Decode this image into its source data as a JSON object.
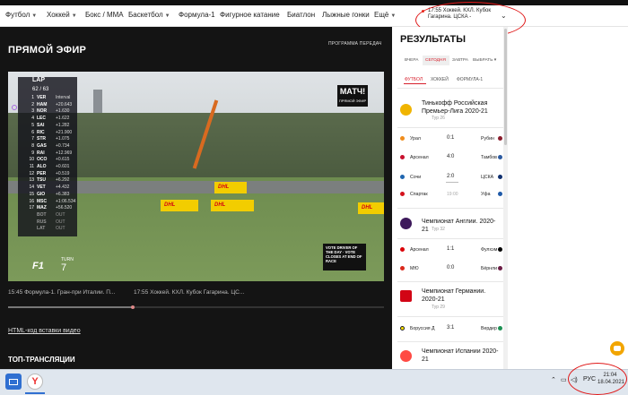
{
  "nav": {
    "items": [
      {
        "label": "Футбол",
        "dropdown": true
      },
      {
        "label": "Хоккей",
        "dropdown": true
      },
      {
        "label": "Бокс / ММА",
        "dropdown": false
      },
      {
        "label": "Баскетбол",
        "dropdown": true
      },
      {
        "label": "Формула-1",
        "dropdown": false
      },
      {
        "label": "Фигурное катание",
        "dropdown": false
      },
      {
        "label": "Биатлон",
        "dropdown": false
      },
      {
        "label": "Лыжные гонки",
        "dropdown": false
      },
      {
        "label": "Ещё",
        "dropdown": true
      }
    ],
    "current_match": "17:55 Хоккей. КХЛ. Кубок Гагарина. ЦСКА -"
  },
  "live": {
    "title": "ПРЯМОЙ ЭФИР",
    "schedule_link": "ПРОГРАММА ПЕРЕДАЧ",
    "embed_link": "HTML-код вставки видео",
    "top_streams": "ТОП-ТРАНСЛЯЦИИ",
    "thumbs": [
      "15:45 Формула-1. Гран-при Италии. П...",
      "17:55 Хоккей. КХЛ. Кубок Гагарина. ЦС..."
    ],
    "progress_fraction": 0.33
  },
  "video": {
    "lap_label": "LAP",
    "lap_count": "62 / 63",
    "interval_label": "Interval",
    "standings": [
      {
        "pos": "1",
        "code": "VER",
        "time": "Interval"
      },
      {
        "pos": "2",
        "code": "HAM",
        "time": "+20.643"
      },
      {
        "pos": "3",
        "code": "NOR",
        "time": "+1.630"
      },
      {
        "pos": "4",
        "code": "LEC",
        "time": "+1.622"
      },
      {
        "pos": "5",
        "code": "SAI",
        "time": "+1.282"
      },
      {
        "pos": "6",
        "code": "RIC",
        "time": "+21.900"
      },
      {
        "pos": "7",
        "code": "STR",
        "time": "+1.075"
      },
      {
        "pos": "8",
        "code": "GAS",
        "time": "+0.734"
      },
      {
        "pos": "9",
        "code": "RAI",
        "time": "+12.969"
      },
      {
        "pos": "10",
        "code": "OCO",
        "time": "+0.615"
      },
      {
        "pos": "11",
        "code": "ALO",
        "time": "+0.601"
      },
      {
        "pos": "12",
        "code": "PER",
        "time": "+0.519"
      },
      {
        "pos": "13",
        "code": "TSU",
        "time": "+6.292"
      },
      {
        "pos": "14",
        "code": "VET",
        "time": "+4.432"
      },
      {
        "pos": "15",
        "code": "GIO",
        "time": "+6.383"
      },
      {
        "pos": "16",
        "code": "MSC",
        "time": "+1:06.534"
      },
      {
        "pos": "17",
        "code": "MAZ",
        "time": "+56.520"
      },
      {
        "pos": "",
        "code": "BOT",
        "time": "OUT",
        "dim": true
      },
      {
        "pos": "",
        "code": "RUS",
        "time": "OUT",
        "dim": true
      },
      {
        "pos": "",
        "code": "LAT",
        "time": "OUT",
        "dim": true
      }
    ],
    "channel_logo": "МАТЧ!",
    "channel_sub": "ПРЯМОЙ ЭФИР",
    "sponsor": "DHL",
    "vote_text": "VOTE DRIVER OF THE DAY · VOTE CLOSES AT END OF RACE",
    "f1_logo": "F1",
    "turn_label": "TURN",
    "turn_number": "7"
  },
  "results": {
    "title": "РЕЗУЛЬТАТЫ",
    "day_tabs": [
      "ВЧЕРА",
      "СЕГОДНЯ",
      "ЗАВТРА",
      "ВЫБРАТЬ"
    ],
    "active_day": "СЕГОДНЯ",
    "sport_tabs": [
      "ФУТБОЛ",
      "ХОККЕЙ",
      "ФОРМУЛА-1"
    ],
    "active_sport": "ФУТБОЛ",
    "leagues": [
      {
        "name": "Тинькофф Российская Премьер-Лига 2020-21",
        "tour": "Тур 26",
        "color": "#f0b400",
        "matches": [
          {
            "home": "Урал",
            "score": "0:1",
            "away": "Рубин"
          },
          {
            "home": "Арсенал",
            "score": "4:0",
            "away": "Тамбов"
          },
          {
            "home": "Сочи",
            "score": "2:0",
            "away": "ЦСКА"
          },
          {
            "home": "Спартак",
            "score": "19:00",
            "away": "Уфа",
            "upcoming": true
          }
        ]
      },
      {
        "name": "Чемпионат Англии. 2020-21",
        "tour": "Тур 32",
        "color": "#3d195b",
        "matches": [
          {
            "home": "Арсенал",
            "score": "1:1",
            "away": "Фулхэм"
          },
          {
            "home": "МЮ",
            "score": "0:0",
            "away": "Бёрнли"
          }
        ]
      },
      {
        "name": "Чемпионат Германии. 2020-21",
        "tour": "Тур 29",
        "color": "#d20515",
        "matches": [
          {
            "home": "Боруссия Д",
            "score": "3:1",
            "away": "Вердер"
          }
        ]
      },
      {
        "name": "Чемпионат Испании 2020-21",
        "tour": "",
        "color": "#ff4b44",
        "matches": []
      }
    ]
  },
  "taskbar": {
    "lang": "РУС",
    "time": "21:04",
    "date": "18.04.2021"
  }
}
